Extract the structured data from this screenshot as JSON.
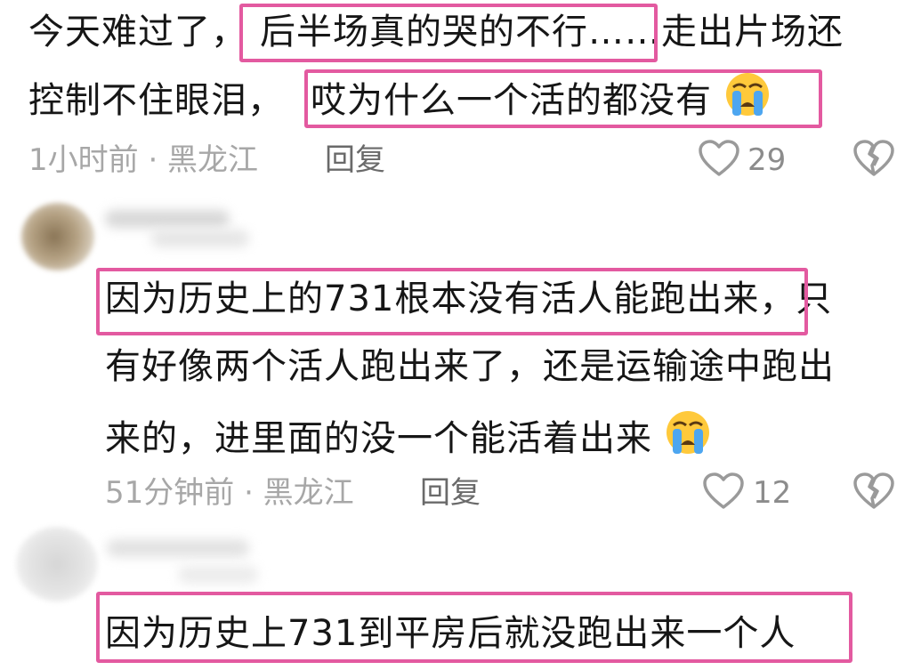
{
  "colors": {
    "highlight_border": "#e35aa0",
    "meta_text": "#a7a7a7",
    "reply_text": "#6a6a6a",
    "body_text": "#161616"
  },
  "comment1": {
    "line1_a": "今天难过了，",
    "line1_b": "后半场真的哭的不行……",
    "line1_c": "走出片场还",
    "line2_a": "控制不住眼泪，",
    "line2_b": "哎为什么一个活的都没有",
    "emoji": "loudly-crying-face-icon",
    "meta": "1小时前 · 黑龙江",
    "reply": "回复",
    "likes": "29"
  },
  "comment2": {
    "line1_a": "因为历史上的731根本没有活人能跑出来",
    "line1_b": "，只",
    "line2": "有好像两个活人跑出来了，还是运输途中跑出",
    "line3": "来的，进里面的没一个能活着出来",
    "emoji": "loudly-crying-face-icon",
    "meta": "51分钟前 · 黑龙江",
    "reply": "回复",
    "likes": "12"
  },
  "comment3": {
    "line1": "因为历史上731到平房后就没跑出来一个人"
  }
}
